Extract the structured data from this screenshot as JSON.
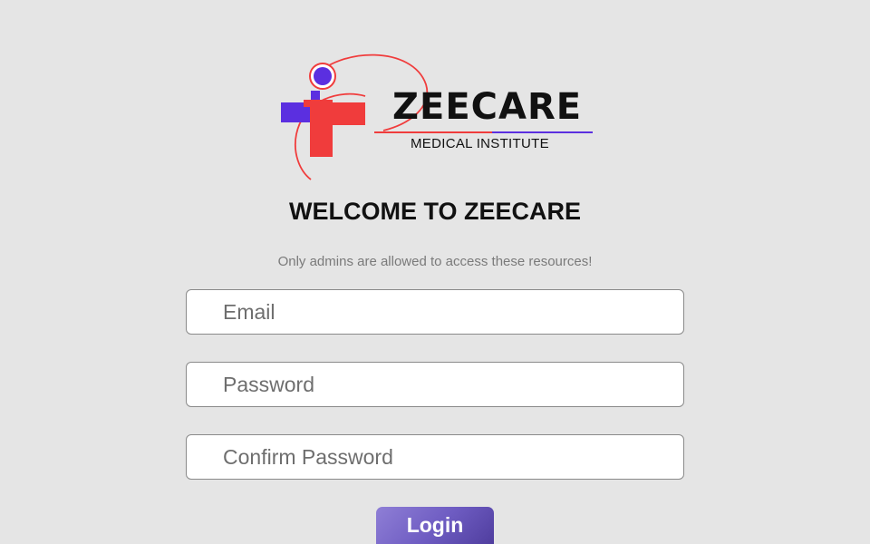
{
  "logo": {
    "brand": "ZEECARE",
    "subtitle": "MEDICAL INSTITUTE",
    "colors": {
      "red": "#f03c3c",
      "purple": "#5b2fe0"
    }
  },
  "heading": "WELCOME TO ZEECARE",
  "notice": "Only admins are allowed to access these resources!",
  "form": {
    "email_placeholder": "Email",
    "password_placeholder": "Password",
    "confirm_placeholder": "Confirm Password",
    "login_label": "Login"
  },
  "colors": {
    "background": "#e5e5e5",
    "button_gradient_start": "#8f7fd6",
    "button_gradient_end": "#4c3a9a"
  }
}
